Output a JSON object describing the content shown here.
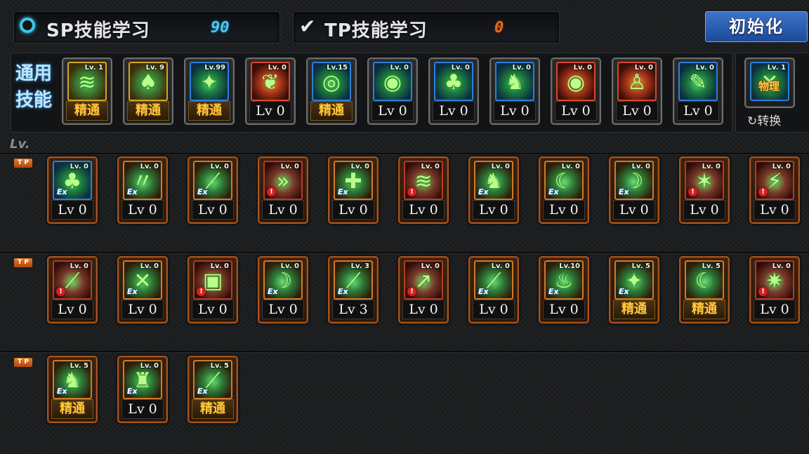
{
  "header": {
    "sp": {
      "title": "SP技能学习",
      "points": "90",
      "icon": "ring-icon"
    },
    "tp": {
      "title": "TP技能学习",
      "points": "0",
      "icon": "checkmark-icon"
    },
    "reset_label": "初始化"
  },
  "common_skills": {
    "label": "通用\n技能",
    "items": [
      {
        "lv": "Lv. 1",
        "level": "精通",
        "mastered": true,
        "theme": "gold",
        "glyph": "≋"
      },
      {
        "lv": "Lv. 9",
        "level": "精通",
        "mastered": true,
        "theme": "gold",
        "glyph": "♠"
      },
      {
        "lv": "Lv.99",
        "level": "精通",
        "mastered": true,
        "theme": "blue",
        "glyph": "✦"
      },
      {
        "lv": "Lv. 0",
        "level": "Lv 0",
        "mastered": false,
        "theme": "red",
        "glyph": "❦"
      },
      {
        "lv": "Lv.15",
        "level": "精通",
        "mastered": true,
        "theme": "blue",
        "glyph": "◎"
      },
      {
        "lv": "Lv. 0",
        "level": "Lv 0",
        "mastered": false,
        "theme": "blue",
        "glyph": "◉"
      },
      {
        "lv": "Lv. 0",
        "level": "Lv 0",
        "mastered": false,
        "theme": "blue",
        "glyph": "♣"
      },
      {
        "lv": "Lv. 0",
        "level": "Lv 0",
        "mastered": false,
        "theme": "blue",
        "glyph": "♞"
      },
      {
        "lv": "Lv. 0",
        "level": "Lv 0",
        "mastered": false,
        "theme": "red",
        "glyph": "◉"
      },
      {
        "lv": "Lv. 0",
        "level": "Lv 0",
        "mastered": false,
        "theme": "red",
        "glyph": "♙"
      },
      {
        "lv": "Lv. 0",
        "level": "Lv 0",
        "mastered": false,
        "theme": "blue",
        "glyph": "✎"
      }
    ]
  },
  "switch_skill": {
    "lv": "Lv. 1",
    "badge": "物理",
    "label": "↻转换",
    "theme": "blue",
    "glyph": "✕"
  },
  "lv_header": "Lv.",
  "tp_tag": "T P",
  "tp_rows": [
    [
      {
        "lv": "Lv. 0",
        "level": "Lv 0",
        "mastered": false,
        "theme": "blue",
        "glyph": "♣",
        "badge": "ex"
      },
      {
        "lv": "Lv. 0",
        "level": "Lv 0",
        "mastered": false,
        "theme": "orange",
        "glyph": "〃",
        "badge": "ex"
      },
      {
        "lv": "Lv. 0",
        "level": "Lv 0",
        "mastered": false,
        "theme": "orange",
        "glyph": "⟋",
        "badge": "ex"
      },
      {
        "lv": "Lv. 0",
        "level": "Lv 0",
        "mastered": false,
        "theme": "redg",
        "glyph": "»",
        "badge": "warn"
      },
      {
        "lv": "Lv. 0",
        "level": "Lv 0",
        "mastered": false,
        "theme": "orange",
        "glyph": "✚",
        "badge": "ex"
      },
      {
        "lv": "Lv. 0",
        "level": "Lv 0",
        "mastered": false,
        "theme": "redg",
        "glyph": "≋",
        "badge": "warn"
      },
      {
        "lv": "Lv. 0",
        "level": "Lv 0",
        "mastered": false,
        "theme": "orange",
        "glyph": "♞",
        "badge": "ex"
      },
      {
        "lv": "Lv. 0",
        "level": "Lv 0",
        "mastered": false,
        "theme": "orange",
        "glyph": "☾",
        "badge": "ex"
      },
      {
        "lv": "Lv. 0",
        "level": "Lv 0",
        "mastered": false,
        "theme": "orange",
        "glyph": "☽",
        "badge": "ex"
      },
      {
        "lv": "Lv. 0",
        "level": "Lv 0",
        "mastered": false,
        "theme": "redg",
        "glyph": "✶",
        "badge": "warn"
      },
      {
        "lv": "Lv. 0",
        "level": "Lv 0",
        "mastered": false,
        "theme": "redg",
        "glyph": "⚡",
        "badge": "warn"
      }
    ],
    [
      {
        "lv": "Lv. 0",
        "level": "Lv 0",
        "mastered": false,
        "theme": "redg",
        "glyph": "⟋",
        "badge": "warn"
      },
      {
        "lv": "Lv. 0",
        "level": "Lv 0",
        "mastered": false,
        "theme": "orange",
        "glyph": "✕",
        "badge": "ex"
      },
      {
        "lv": "Lv. 0",
        "level": "Lv 0",
        "mastered": false,
        "theme": "redg",
        "glyph": "▣",
        "badge": "warn"
      },
      {
        "lv": "Lv. 0",
        "level": "Lv 0",
        "mastered": false,
        "theme": "orange",
        "glyph": "☽",
        "badge": "ex"
      },
      {
        "lv": "Lv. 3",
        "level": "Lv 3",
        "mastered": false,
        "theme": "orange",
        "glyph": "⟋",
        "badge": "ex"
      },
      {
        "lv": "Lv. 0",
        "level": "Lv 0",
        "mastered": false,
        "theme": "redg",
        "glyph": "↗",
        "badge": "warn"
      },
      {
        "lv": "Lv. 0",
        "level": "Lv 0",
        "mastered": false,
        "theme": "orange",
        "glyph": "⟋",
        "badge": "ex"
      },
      {
        "lv": "Lv.10",
        "level": "Lv 0",
        "mastered": false,
        "theme": "orange",
        "glyph": "♨",
        "badge": "ex"
      },
      {
        "lv": "Lv. 5",
        "level": "精通",
        "mastered": true,
        "theme": "orange",
        "glyph": "✦",
        "badge": "ex"
      },
      {
        "lv": "Lv. 5",
        "level": "精通",
        "mastered": true,
        "theme": "orange",
        "glyph": "☾",
        "badge": "none"
      },
      {
        "lv": "Lv. 0",
        "level": "Lv 0",
        "mastered": false,
        "theme": "redg",
        "glyph": "✷",
        "badge": "warn"
      }
    ],
    [
      {
        "lv": "Lv. 5",
        "level": "精通",
        "mastered": true,
        "theme": "orange",
        "glyph": "♞",
        "badge": "ex"
      },
      {
        "lv": "Lv. 0",
        "level": "Lv 0",
        "mastered": false,
        "theme": "orange",
        "glyph": "♜",
        "badge": "ex"
      },
      {
        "lv": "Lv. 5",
        "level": "精通",
        "mastered": true,
        "theme": "orange",
        "glyph": "⟋",
        "badge": "ex"
      }
    ]
  ]
}
